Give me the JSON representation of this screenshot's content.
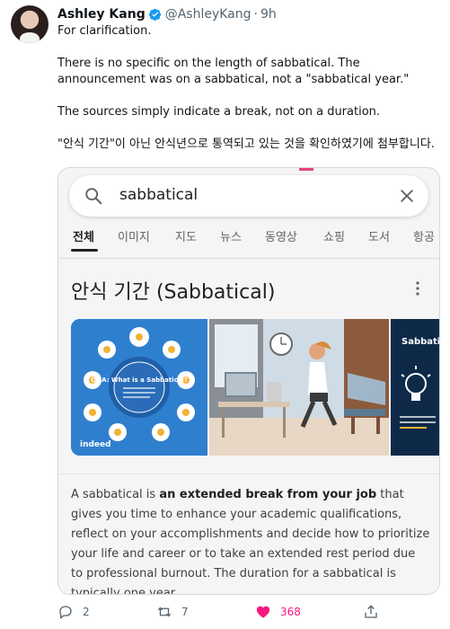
{
  "tweet": {
    "author_name": "Ashley Kang",
    "handle": "@AshleyKang",
    "separator": "·",
    "time": "9h",
    "paragraphs": [
      "For clarification.",
      "There is no specific on the length of sabbatical. The announcement was on a sabbatical, not a \"sabbatical year.\"",
      "The sources simply indicate a break, not on a duration.",
      "\"안식 기간\"이 아닌 안식년으로 통역되고 있는 것을 확인하였기에 첨부합니다."
    ]
  },
  "google_card": {
    "search_query": "sabbatical",
    "tabs": [
      "전체",
      "이미지",
      "지도",
      "뉴스",
      "동영상",
      "쇼핑",
      "도서",
      "항공"
    ],
    "active_tab": "전체",
    "panel_title": "안식 기간 (Sabbatical)",
    "image1": {
      "brand": "indeed",
      "heading": "Q&A: What is a Sabbatical?"
    },
    "image3": {
      "heading": "Sabbati"
    },
    "description": {
      "pre": "A sabbatical is ",
      "bold": "an extended break from your job",
      "post": " that gives you time to enhance your academic qualifications, reflect on your accomplishments and decide how to prioritize your life and career or to take an extended rest period due to professional burnout. The duration for a sabbatical is typically one year."
    }
  },
  "actions": {
    "reply_count": "2",
    "retweet_count": "7",
    "like_count": "368"
  },
  "colors": {
    "verified": "#1d9bf0",
    "like": "#f91880",
    "secondary_text": "#536471"
  }
}
